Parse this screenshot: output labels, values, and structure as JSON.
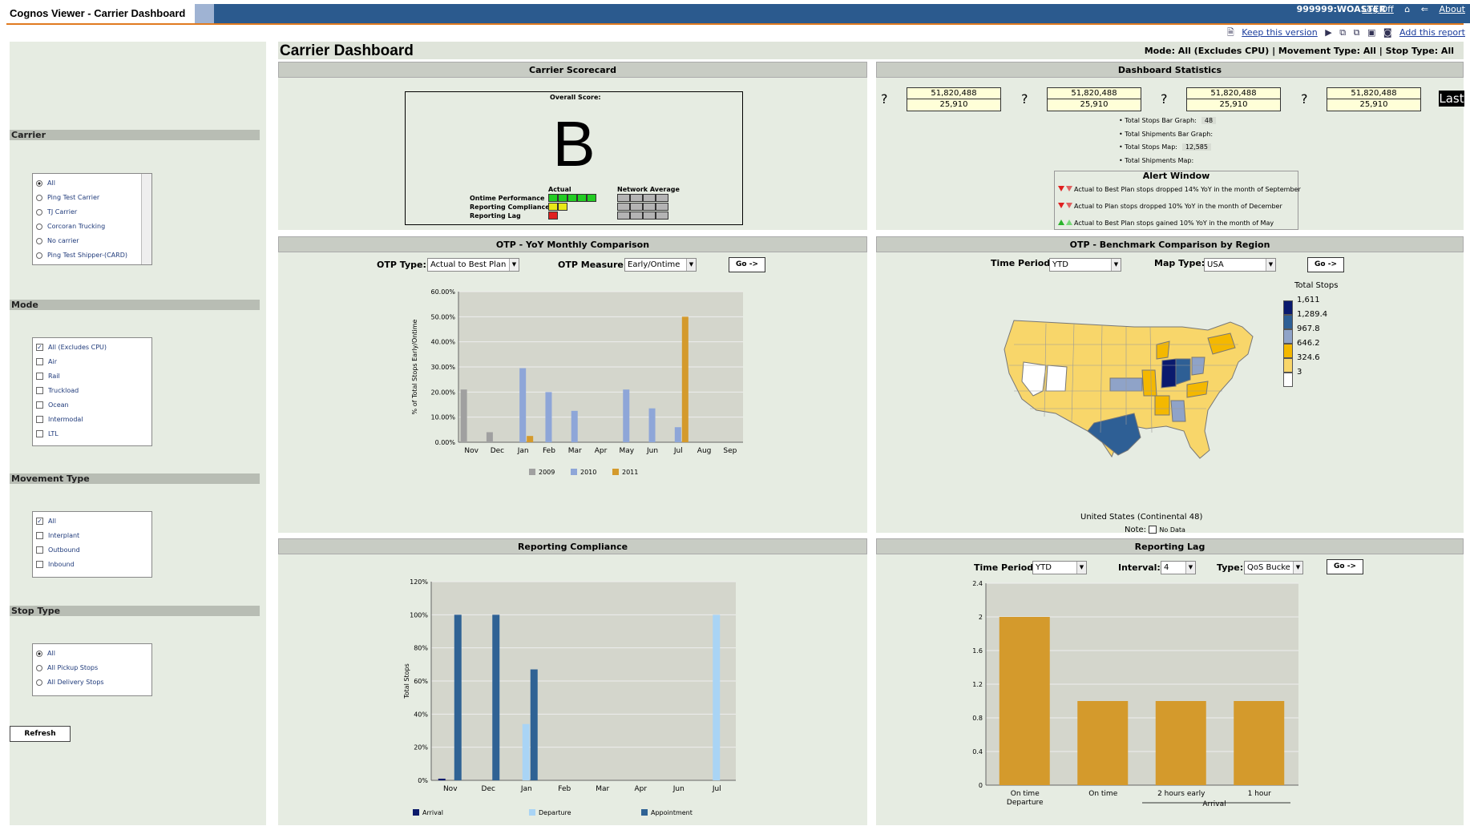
{
  "app": {
    "title": "Cognos Viewer - Carrier Dashboard",
    "user": "999999:WOASTER",
    "logoff": "Log Off",
    "about": "About",
    "keep_version": "Keep this version",
    "add_report": "Add this report"
  },
  "page": {
    "title": "Carrier Dashboard",
    "filters": "Mode: All (Excludes CPU)  |  Movement Type: All  |  Stop Type: All"
  },
  "left": {
    "carrier": {
      "title": "Carrier",
      "options": [
        "All",
        "Ping Test Carrier",
        "TJ Carrier",
        "Corcoran Trucking",
        "No carrier",
        "Ping Test Shipper-(CARD)"
      ],
      "selected": "All"
    },
    "mode": {
      "title": "Mode",
      "options": [
        "All (Excludes CPU)",
        "Air",
        "Rail",
        "Truckload",
        "Ocean",
        "Intermodal",
        "LTL"
      ],
      "checked": [
        "All (Excludes CPU)"
      ]
    },
    "movement": {
      "title": "Movement Type",
      "options": [
        "All",
        "Interplant",
        "Outbound",
        "Inbound"
      ],
      "checked": [
        "All"
      ]
    },
    "stop": {
      "title": "Stop Type",
      "options": [
        "All",
        "All Pickup Stops",
        "All Delivery Stops"
      ],
      "selected": "All"
    },
    "refresh": "Refresh"
  },
  "scorecard": {
    "title": "Carrier Scorecard",
    "overall_label": "Overall Score:",
    "grade": "B",
    "actual_label": "Actual",
    "network_label": "Network Average",
    "rows": [
      "Ontime Performance",
      "Reporting Compliance",
      "Reporting Lag"
    ],
    "actual_cells": [
      [
        "#22cc22",
        "#22cc22",
        "#22cc22",
        "#22cc22",
        "#22cc22"
      ],
      [
        "#e8e818",
        "#e8e818"
      ],
      [
        "#e02020"
      ]
    ],
    "network_cells": [
      [
        "#b4b4b4",
        "#b4b4b4",
        "#b4b4b4",
        "#b4b4b4"
      ],
      [
        "#b4b4b4",
        "#b4b4b4",
        "#b4b4b4",
        "#b4b4b4"
      ],
      [
        "#b4b4b4",
        "#b4b4b4",
        "#b4b4b4",
        "#b4b4b4"
      ]
    ]
  },
  "stats": {
    "title": "Dashboard Statistics",
    "boxes": [
      {
        "top": "51,820,488",
        "bottom": "25,910"
      },
      {
        "top": "51,820,488",
        "bottom": "25,910"
      },
      {
        "top": "51,820,488",
        "bottom": "25,910"
      },
      {
        "top": "51,820,488",
        "bottom": "25,910"
      }
    ],
    "qmark": "?",
    "last": "Last",
    "bullets": [
      {
        "label": "Total Stops Bar Graph:",
        "value": "48"
      },
      {
        "label": "Total Shipments Bar Graph:",
        "value": ""
      },
      {
        "label": "Total Stops Map:",
        "value": "12,585"
      },
      {
        "label": "Total Shipments Map:",
        "value": ""
      }
    ],
    "alert_title": "Alert Window",
    "alerts": [
      {
        "dir": "down",
        "text": "Actual to Best Plan stops dropped 14% YoY in the month of September"
      },
      {
        "dir": "down",
        "text": "Actual to Plan stops dropped 10% YoY in the month of December"
      },
      {
        "dir": "up",
        "text": "Actual to Best Plan stops gained 10% YoY in the month of May"
      }
    ]
  },
  "otp": {
    "title": "OTP - YoY Monthly Comparison",
    "type_label": "OTP Type:",
    "type_value": "Actual to Best Plan",
    "measure_label": "OTP Measure:",
    "measure_value": "Early/Ontime",
    "go": "Go ->"
  },
  "benchmark": {
    "title": "OTP - Benchmark Comparison by Region",
    "period_label": "Time Period:",
    "period_value": "YTD",
    "maptype_label": "Map Type:",
    "maptype_value": "USA",
    "go": "Go ->",
    "legend_title": "Total Stops",
    "legend": [
      {
        "label": "1,611",
        "color": "#0a1a6e"
      },
      {
        "label": "1,289.4",
        "color": "#2e5f95"
      },
      {
        "label": "967.8",
        "color": "#8fa3c8"
      },
      {
        "label": "646.2",
        "color": "#f4b800"
      },
      {
        "label": "324.6",
        "color": "#f8d66a"
      },
      {
        "label": "3",
        "color": "#ffffff"
      }
    ],
    "map_caption": "United States (Continental 48)",
    "note_label": "Note:",
    "no_data": "No Data"
  },
  "compliance": {
    "title": "Reporting Compliance"
  },
  "lag": {
    "title": "Reporting Lag",
    "period_label": "Time Period:",
    "period_value": "YTD",
    "interval_label": "Interval:",
    "interval_value": "4",
    "type_label": "Type:",
    "type_value": "QoS Bucke",
    "go": "Go ->"
  },
  "chart_data": [
    {
      "type": "bar",
      "title": "",
      "ylabel": "% of Total Stops Early/Ontime",
      "categories": [
        "Nov",
        "Dec",
        "Jan",
        "Feb",
        "Mar",
        "Apr",
        "May",
        "Jun",
        "Jul",
        "Aug",
        "Sep"
      ],
      "yticks": [
        "0.00%",
        "10.00%",
        "20.00%",
        "30.00%",
        "40.00%",
        "50.00%",
        "60.00%"
      ],
      "ylim": [
        0,
        60
      ],
      "series": [
        {
          "name": "2009",
          "color": "#a0a0a0",
          "values": [
            21,
            4,
            0,
            0,
            0,
            0,
            0,
            0,
            0,
            0,
            0
          ]
        },
        {
          "name": "2010",
          "color": "#8ea6d8",
          "values": [
            0,
            0,
            29.5,
            20,
            12.5,
            0,
            21,
            13.5,
            6,
            0,
            0
          ]
        },
        {
          "name": "2011",
          "color": "#d49a2c",
          "values": [
            0,
            0,
            2.5,
            0,
            0,
            0,
            0,
            0,
            50,
            0,
            0
          ]
        }
      ]
    },
    {
      "type": "bar",
      "title": "",
      "ylabel": "Total Stops",
      "categories": [
        "Nov",
        "Dec",
        "Jan",
        "Feb",
        "Mar",
        "Apr",
        "Jun",
        "Jul"
      ],
      "yticks": [
        "0%",
        "20%",
        "40%",
        "60%",
        "80%",
        "100%",
        "120%"
      ],
      "ylim": [
        0,
        120
      ],
      "series": [
        {
          "name": "Arrival",
          "color": "#0b1a6a",
          "values": [
            1,
            0,
            0,
            0,
            0,
            0,
            0,
            0
          ]
        },
        {
          "name": "Departure",
          "color": "#a9d4f5",
          "values": [
            0,
            0,
            34,
            0,
            0,
            0,
            0,
            100
          ]
        },
        {
          "name": "Appointment",
          "color": "#2f6294",
          "values": [
            100,
            100,
            67,
            0,
            0,
            0,
            0,
            0
          ]
        }
      ]
    },
    {
      "type": "bar",
      "title": "",
      "ylabel": "",
      "categories": [
        "On time Departure",
        "On time",
        "2 hours early",
        "1 hour"
      ],
      "group_label": "Arrival",
      "yticks": [
        "0",
        "0.4",
        "0.8",
        "1.2",
        "1.6",
        "2",
        "2.4"
      ],
      "ylim": [
        0,
        2.4
      ],
      "series": [
        {
          "name": "",
          "color": "#d49a2c",
          "values": [
            2,
            1,
            1,
            1
          ]
        }
      ]
    }
  ]
}
